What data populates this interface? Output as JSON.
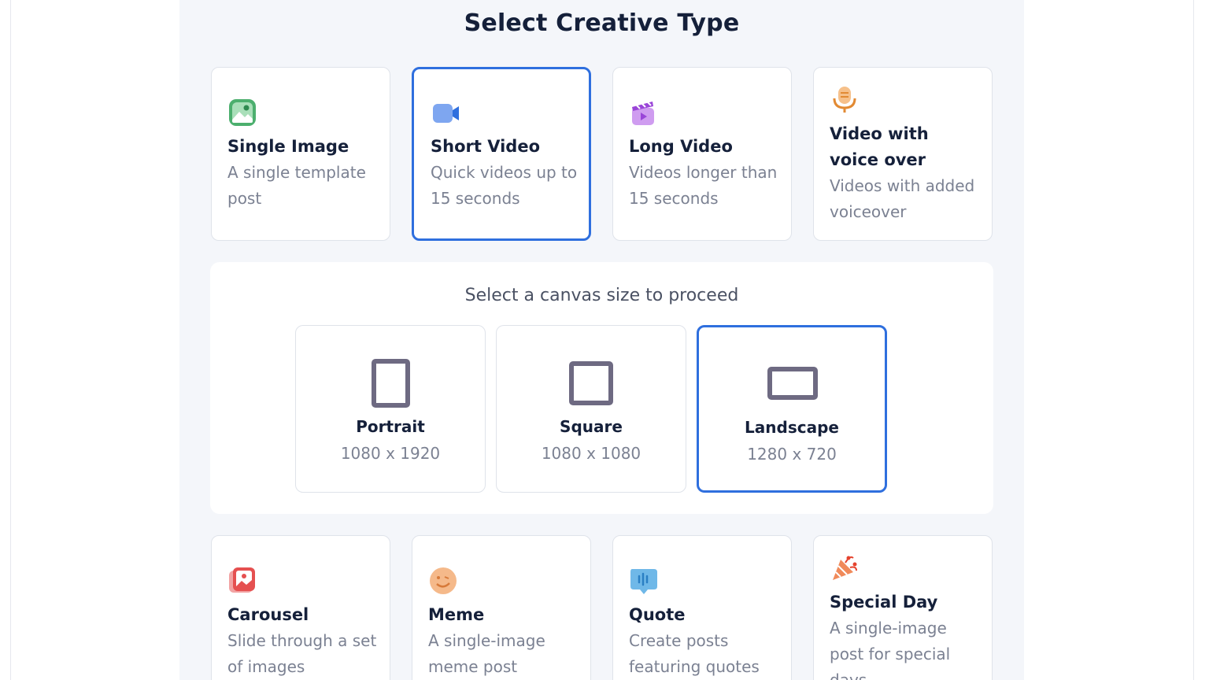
{
  "page": {
    "title": "Select Creative Type"
  },
  "creative_types_top": [
    {
      "title": "Single Image",
      "desc": "A single template post",
      "icon": "image-icon",
      "selected": false
    },
    {
      "title": "Short Video",
      "desc": "Quick videos up to 15 seconds",
      "icon": "video-camera-icon",
      "selected": true
    },
    {
      "title": "Long Video",
      "desc": "Videos longer than 15 seconds",
      "icon": "clapperboard-icon",
      "selected": false
    },
    {
      "title": "Video with voice over",
      "desc": "Videos with added voiceover",
      "icon": "microphone-icon",
      "selected": false
    }
  ],
  "canvas": {
    "heading": "Select a canvas size to proceed",
    "sizes": [
      {
        "name": "Portrait",
        "dimensions": "1080 x 1920",
        "icon": "portrait-icon",
        "selected": false
      },
      {
        "name": "Square",
        "dimensions": "1080 x 1080",
        "icon": "square-icon",
        "selected": false
      },
      {
        "name": "Landscape",
        "dimensions": "1280 x 720",
        "icon": "landscape-icon",
        "selected": true
      }
    ]
  },
  "creative_types_bottom": [
    {
      "title": "Carousel",
      "desc": "Slide through a set of images",
      "icon": "carousel-icon",
      "selected": false
    },
    {
      "title": "Meme",
      "desc": "A single-image meme post",
      "icon": "smiley-icon",
      "selected": false
    },
    {
      "title": "Quote",
      "desc": "Create posts featuring quotes",
      "icon": "quote-bubble-icon",
      "selected": false
    },
    {
      "title": "Special Day",
      "desc": "A single-image post for special days",
      "icon": "party-popper-icon",
      "selected": false
    }
  ],
  "colors": {
    "accent": "#2f6fde",
    "title_text": "#15203a",
    "muted_text": "#7b8192",
    "panel_bg": "#f4f6fa"
  }
}
